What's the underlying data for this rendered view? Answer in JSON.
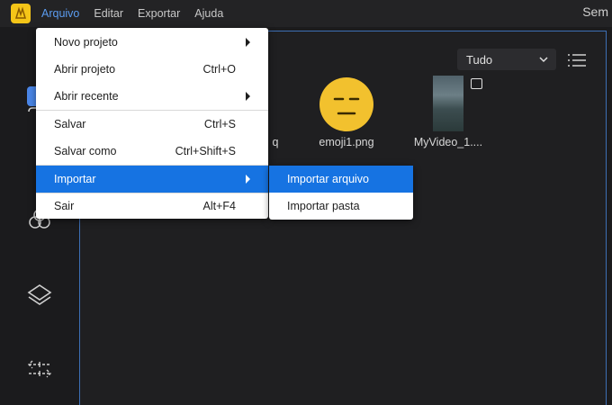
{
  "menubar": {
    "logo_icon": "app-logo-icon",
    "items": [
      "Arquivo",
      "Editar",
      "Exportar",
      "Ajuda"
    ],
    "window_title": "Sem"
  },
  "main": {
    "filter_value": "Tudo",
    "media": [
      {
        "name_fragment": "q",
        "type": "image"
      },
      {
        "name": "emoji1.png",
        "type": "image"
      },
      {
        "name": "MyVideo_1....",
        "type": "video"
      }
    ]
  },
  "file_menu": {
    "items": [
      {
        "label": "Novo projeto",
        "shortcut": "",
        "submenu": true
      },
      {
        "label": "Abrir projeto",
        "shortcut": "Ctrl+O",
        "submenu": false
      },
      {
        "label": "Abrir recente",
        "shortcut": "",
        "submenu": true
      },
      {
        "label": "Salvar",
        "shortcut": "Ctrl+S",
        "submenu": false
      },
      {
        "label": "Salvar como",
        "shortcut": "Ctrl+Shift+S",
        "submenu": false
      },
      {
        "label": "Importar",
        "shortcut": "",
        "submenu": true
      },
      {
        "label": "Sair",
        "shortcut": "Alt+F4",
        "submenu": false
      }
    ]
  },
  "import_submenu": {
    "items": [
      "Importar arquivo",
      "Importar pasta"
    ]
  },
  "colors": {
    "accent": "#1673e2",
    "menu_active": "#5b9cf0",
    "logo": "#f5c518"
  }
}
